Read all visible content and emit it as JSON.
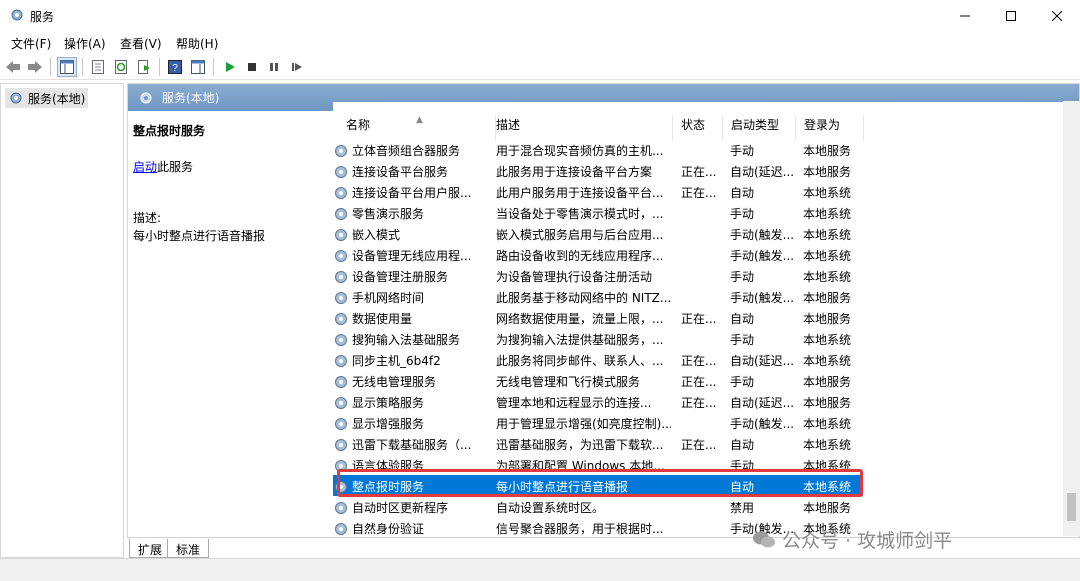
{
  "window": {
    "title": "服务"
  },
  "menu": [
    "文件(F)",
    "操作(A)",
    "查看(V)",
    "帮助(H)"
  ],
  "tree": {
    "item": "服务(本地)"
  },
  "panel": {
    "header": "服务(本地)",
    "detail": {
      "title": "整点报时服务",
      "start_link": "启动",
      "start_suffix": "此服务",
      "desc_label": "描述:",
      "desc": "每小时整点进行语音播报"
    },
    "columns": [
      "名称",
      "描述",
      "状态",
      "启动类型",
      "登录为"
    ]
  },
  "services": [
    {
      "name": "立体音频组合器服务",
      "desc": "用于混合现实音频仿真的主机...",
      "status": "",
      "start": "手动",
      "logon": "本地服务"
    },
    {
      "name": "连接设备平台服务",
      "desc": "此服务用于连接设备平台方案",
      "status": "正在...",
      "start": "自动(延迟...",
      "logon": "本地服务"
    },
    {
      "name": "连接设备平台用户服...",
      "desc": "此用户服务用于连接设备平台...",
      "status": "正在...",
      "start": "自动",
      "logon": "本地系统"
    },
    {
      "name": "零售演示服务",
      "desc": "当设备处于零售演示模式时，...",
      "status": "",
      "start": "手动",
      "logon": "本地系统"
    },
    {
      "name": "嵌入模式",
      "desc": "嵌入模式服务启用与后台应用...",
      "status": "",
      "start": "手动(触发...",
      "logon": "本地系统"
    },
    {
      "name": "设备管理无线应用程...",
      "desc": "路由设备收到的无线应用程序...",
      "status": "",
      "start": "手动(触发...",
      "logon": "本地系统"
    },
    {
      "name": "设备管理注册服务",
      "desc": "为设备管理执行设备注册活动",
      "status": "",
      "start": "手动",
      "logon": "本地系统"
    },
    {
      "name": "手机网络时间",
      "desc": "此服务基于移动网络中的 NITZ...",
      "status": "",
      "start": "手动(触发...",
      "logon": "本地服务"
    },
    {
      "name": "数据使用量",
      "desc": "网络数据使用量，流量上限，...",
      "status": "正在...",
      "start": "自动",
      "logon": "本地服务"
    },
    {
      "name": "搜狗输入法基础服务",
      "desc": "为搜狗输入法提供基础服务，...",
      "status": "",
      "start": "手动",
      "logon": "本地系统"
    },
    {
      "name": "同步主机_6b4f2",
      "desc": "此服务将同步邮件、联系人、...",
      "status": "正在...",
      "start": "自动(延迟...",
      "logon": "本地系统"
    },
    {
      "name": "无线电管理服务",
      "desc": "无线电管理和飞行模式服务",
      "status": "正在...",
      "start": "手动",
      "logon": "本地服务"
    },
    {
      "name": "显示策略服务",
      "desc": "管理本地和远程显示的连接...",
      "status": "正在...",
      "start": "自动(延迟...",
      "logon": "本地服务"
    },
    {
      "name": "显示增强服务",
      "desc": "用于管理显示增强(如亮度控制)...",
      "status": "",
      "start": "手动(触发...",
      "logon": "本地系统"
    },
    {
      "name": "迅雷下载基础服务（...",
      "desc": "迅雷基础服务，为迅雷下载软...",
      "status": "正在...",
      "start": "自动",
      "logon": "本地系统"
    },
    {
      "name": "语言体验服务",
      "desc": "为部署和配置 Windows 本地...",
      "status": "",
      "start": "手动",
      "logon": "本地系统"
    },
    {
      "name": "整点报时服务",
      "desc": "每小时整点进行语音播报",
      "status": "",
      "start": "自动",
      "logon": "本地系统",
      "selected": true
    },
    {
      "name": "自动时区更新程序",
      "desc": "自动设置系统时区。",
      "status": "",
      "start": "禁用",
      "logon": "本地服务"
    },
    {
      "name": "自然身份验证",
      "desc": "信号聚合器服务，用于根据时...",
      "status": "",
      "start": "手动(触发...",
      "logon": "本地系统"
    }
  ],
  "tabs": [
    "扩展",
    "标准"
  ],
  "watermark": "公众号 · 攻城师剑平"
}
